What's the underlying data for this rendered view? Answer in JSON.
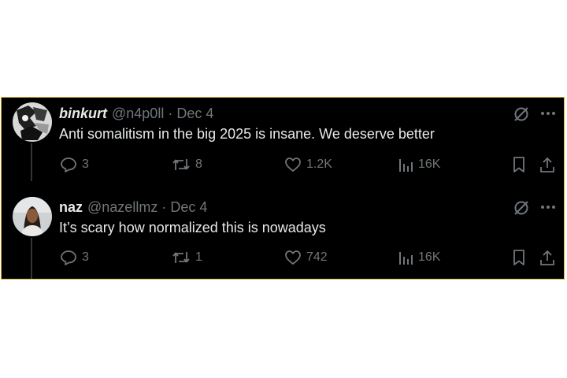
{
  "tweets": [
    {
      "display_name": "binkurt",
      "handle": "@n4p0ll",
      "separator": "·",
      "date": "Dec 4",
      "text": "Anti somalitism in the big 2025 is insane. We deserve better",
      "replies": "3",
      "reposts": "8",
      "likes": "1.2K",
      "views": "16K"
    },
    {
      "display_name": "naz",
      "handle": "@nazellmz",
      "separator": "·",
      "date": "Dec 4",
      "text": "It’s scary how normalized this is nowadays",
      "replies": "3",
      "reposts": "1",
      "likes": "742",
      "views": "16K"
    }
  ],
  "icons": {
    "grok": "grok-slash-circle-icon",
    "more": "more-dots-icon",
    "reply": "reply-bubble-icon",
    "repost": "repost-icon",
    "like": "heart-icon",
    "views": "views-bars-icon",
    "bookmark": "bookmark-icon",
    "share": "share-icon"
  },
  "colors": {
    "background": "#000000",
    "text": "#e7e9ea",
    "muted": "#71767b",
    "frame_border": "#d9b53a"
  }
}
